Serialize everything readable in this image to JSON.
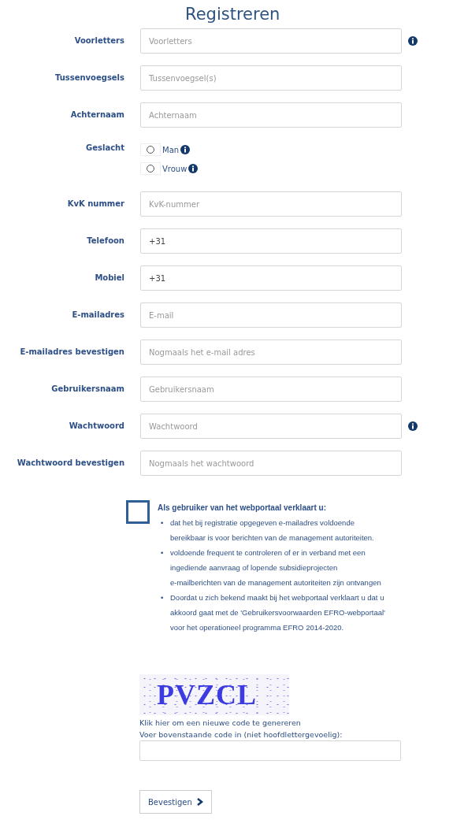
{
  "title": "Registreren",
  "fields": [
    {
      "kind": "input",
      "label": "Voorletters",
      "placeholder": "Voorletters",
      "info": true
    },
    {
      "kind": "input",
      "label": "Tussenvoegsels",
      "placeholder": "Tussenvoegsel(s)",
      "info": false
    },
    {
      "kind": "input",
      "label": "Achternaam",
      "placeholder": "Achternaam",
      "info": false
    },
    {
      "kind": "radio",
      "label": "Geslacht",
      "options": [
        {
          "label": "Man",
          "selected": false,
          "info": true
        },
        {
          "label": "Vrouw",
          "selected": false,
          "info": true
        }
      ]
    },
    {
      "kind": "input",
      "label": "KvK nummer",
      "placeholder": "KvK-nummer",
      "info": false
    },
    {
      "kind": "input",
      "label": "Telefoon",
      "value": "+31",
      "info": false
    },
    {
      "kind": "input",
      "label": "Mobiel",
      "value": "+31",
      "info": false
    },
    {
      "kind": "input",
      "label": "E-mailadres",
      "placeholder": "E-mail",
      "info": false
    },
    {
      "kind": "input",
      "label": "E-mailadres bevestigen",
      "placeholder": "Nogmaals het e-mail adres",
      "info": false
    },
    {
      "kind": "input",
      "label": "Gebruikersnaam",
      "placeholder": "Gebruikersnaam",
      "info": false
    },
    {
      "kind": "input",
      "label": "Wachtwoord",
      "placeholder": "Wachtwoord",
      "info": true
    },
    {
      "kind": "input",
      "label": "Wachtwoord bevestigen",
      "placeholder": "Nogmaals het wachtwoord",
      "info": false
    }
  ],
  "agreement": {
    "checked": false,
    "heading": "Als gebruiker van het webportaal verklaart u:",
    "items": [
      {
        "bullet": "•",
        "lines": [
          "dat het bij registratie opgegeven e-mailadres voldoende",
          "bereikbaar is voor berichten van de management autoriteiten."
        ]
      },
      {
        "bullet": "•",
        "lines": [
          "voldoende frequent te controleren of er in verband met een",
          "ingediende aanvraag of lopende subsidieprojecten",
          "e-mailberichten van de management autoriteiten zijn ontvangen"
        ]
      },
      {
        "bullet": "•",
        "lines": [
          "Doordat u zich bekend maakt bij het webportaal verklaart u dat u",
          "akkoord gaat met de 'Gebruikersvoorwaarden EFRO-webportaal'",
          "voor het operationeel programma EFRO 2014-2020."
        ]
      }
    ]
  },
  "captcha": {
    "code": "PVZCL",
    "refresh_link": "Klik hier om een nieuwe code te genereren",
    "label": "Voer bovenstaande code in (niet hoofdlettergevoelig):"
  },
  "submit": "Bevestigen"
}
